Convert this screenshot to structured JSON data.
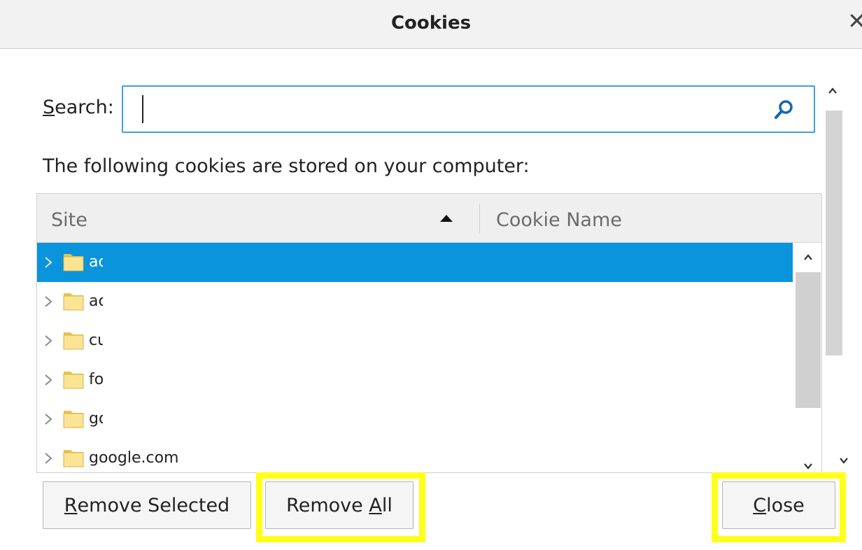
{
  "window": {
    "title": "Cookies",
    "close_icon": "close-icon"
  },
  "search": {
    "label_accesskey": "S",
    "label_rest": "earch:",
    "value": "",
    "placeholder": "",
    "icon": "search-icon"
  },
  "info_text": "The following cookies are stored on your computer:",
  "tree": {
    "columns": [
      {
        "label": "Site",
        "sort": "ascending"
      },
      {
        "label": "Cookie Name"
      }
    ],
    "rows": [
      {
        "label": "ac",
        "selected": true
      },
      {
        "label": "ac",
        "selected": false
      },
      {
        "label": "cu",
        "selected": false
      },
      {
        "label": "fo",
        "selected": false
      },
      {
        "label": "go",
        "selected": false
      },
      {
        "label": "google.com",
        "selected": false
      }
    ]
  },
  "buttons": {
    "remove_selected": {
      "accesskey": "R",
      "rest": "emove Selected"
    },
    "remove_all": {
      "prefix": "Remove ",
      "accesskey": "A",
      "rest": "ll"
    },
    "close": {
      "accesskey": "C",
      "rest": "lose"
    }
  },
  "colors": {
    "selection": "#0a94dc",
    "focus_border": "#3e9fe0",
    "highlight": "#ffff1a"
  }
}
